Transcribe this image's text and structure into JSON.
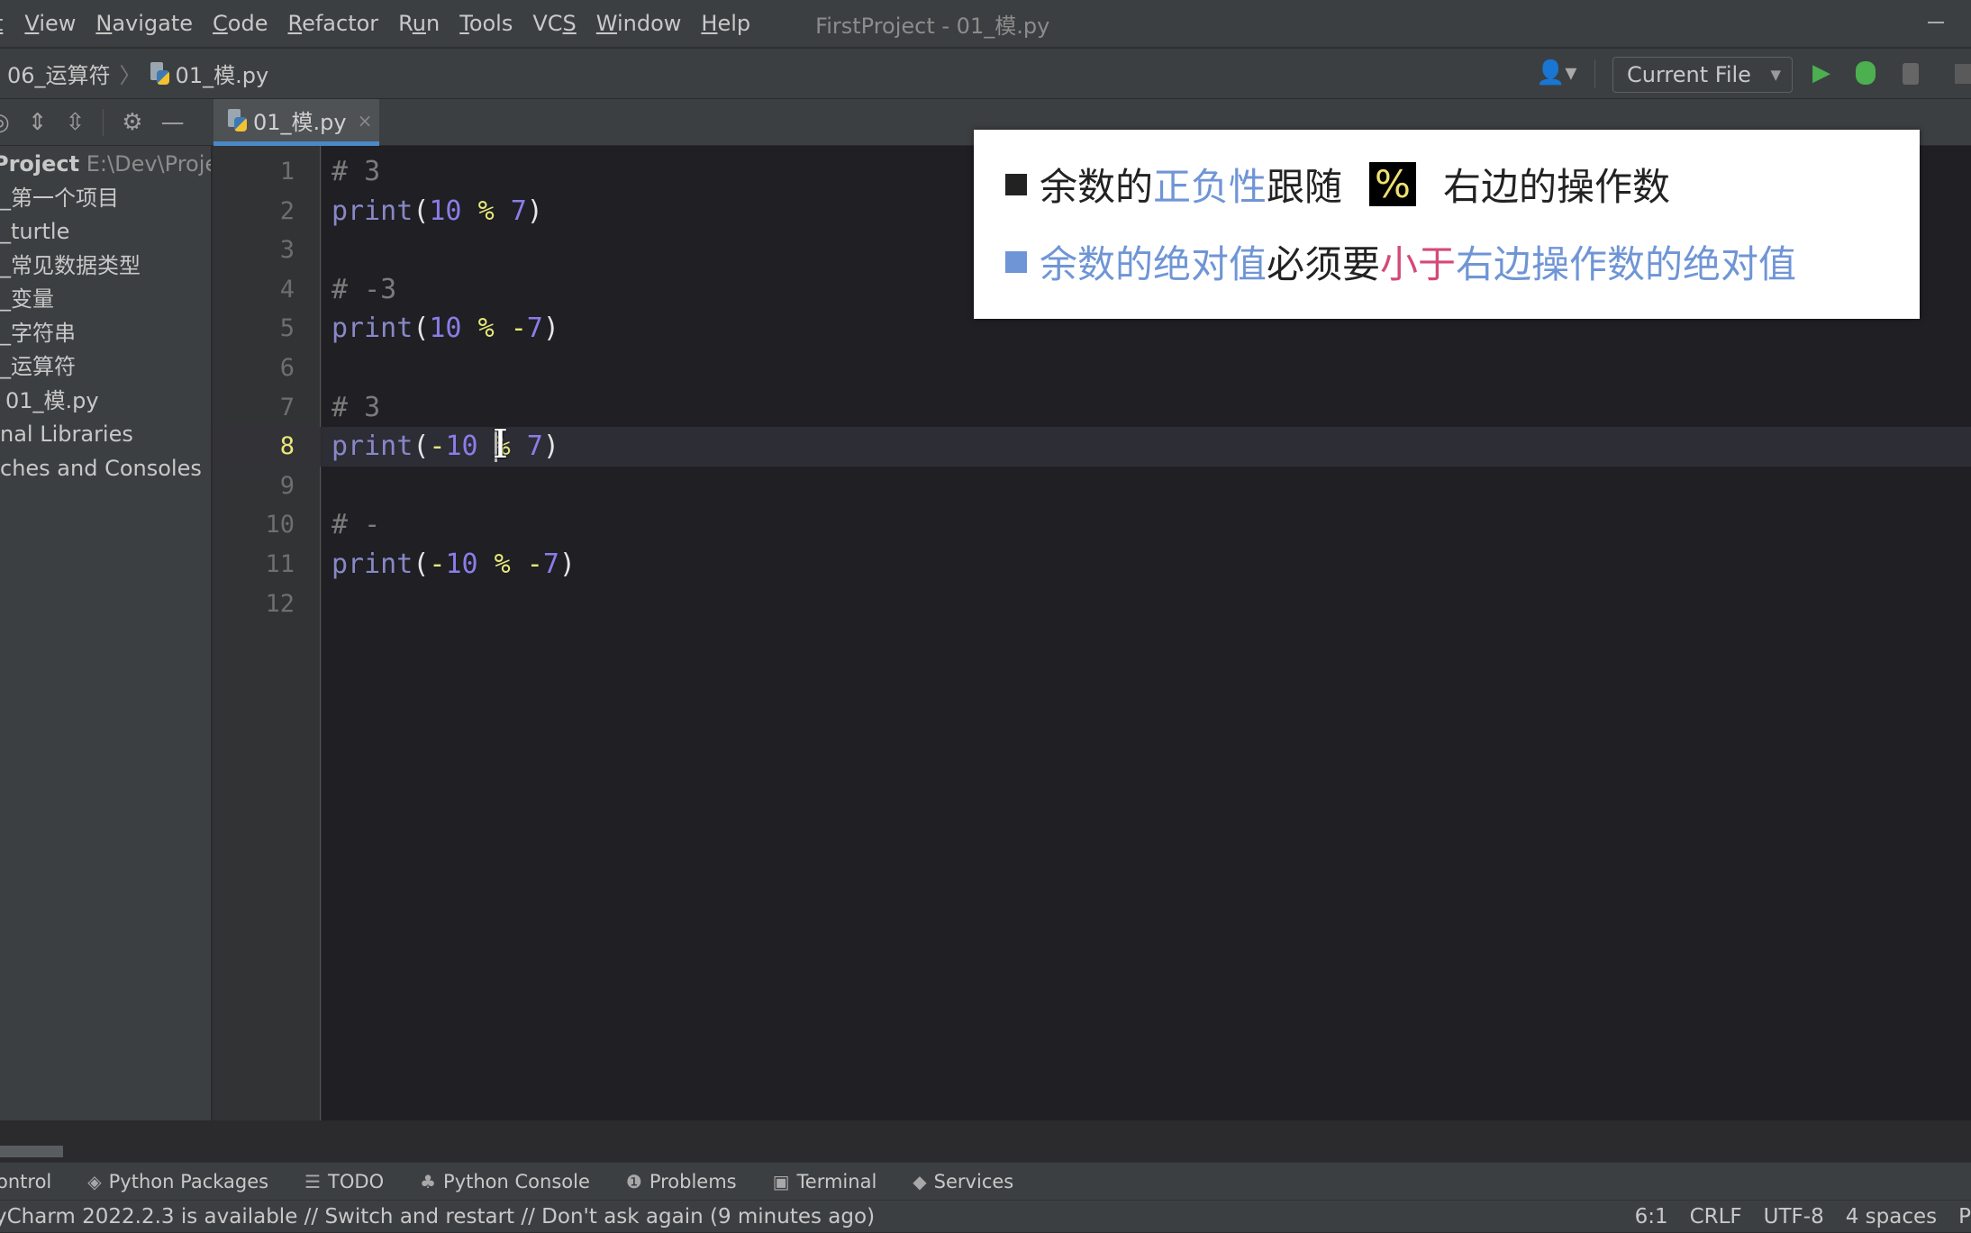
{
  "menu": {
    "items": [
      {
        "pre": "",
        "u": "t",
        "post": "",
        "hidden_prefix": true
      },
      {
        "pre": "",
        "u": "V",
        "post": "iew"
      },
      {
        "pre": "",
        "u": "N",
        "post": "avigate"
      },
      {
        "pre": "",
        "u": "C",
        "post": "ode"
      },
      {
        "pre": "",
        "u": "R",
        "post": "efactor"
      },
      {
        "pre": "R",
        "u": "u",
        "post": "n"
      },
      {
        "pre": "",
        "u": "T",
        "post": "ools"
      },
      {
        "pre": "VC",
        "u": "S",
        "post": ""
      },
      {
        "pre": "",
        "u": "W",
        "post": "indow"
      },
      {
        "pre": "",
        "u": "H",
        "post": "elp"
      }
    ],
    "window_title": "FirstProject - 01_模.py"
  },
  "navbar": {
    "breadcrumb": [
      "06_运算符",
      "01_模.py"
    ],
    "run_config": "Current File"
  },
  "tab": {
    "label": "01_模.py"
  },
  "project": {
    "header_name": "Project",
    "header_path": "E:\\Dev\\Project",
    "items": [
      "_第一个项目",
      "_turtle",
      "_常见数据类型",
      "_变量",
      "_字符串",
      "_运算符",
      "01_模.py",
      "nal Libraries",
      "ches and Consoles"
    ]
  },
  "editor": {
    "current_line": 8,
    "lines": [
      [
        {
          "t": "# 3",
          "c": "comment"
        }
      ],
      [
        {
          "t": "print",
          "c": "fn"
        },
        {
          "t": "(",
          "c": "paren"
        },
        {
          "t": "10",
          "c": "num"
        },
        {
          "t": " ",
          "c": "paren"
        },
        {
          "t": "%",
          "c": "op"
        },
        {
          "t": " ",
          "c": "paren"
        },
        {
          "t": "7",
          "c": "num"
        },
        {
          "t": ")",
          "c": "paren"
        }
      ],
      [],
      [
        {
          "t": "# -3",
          "c": "comment"
        }
      ],
      [
        {
          "t": "print",
          "c": "fn"
        },
        {
          "t": "(",
          "c": "paren"
        },
        {
          "t": "10",
          "c": "num"
        },
        {
          "t": " ",
          "c": "paren"
        },
        {
          "t": "%",
          "c": "op"
        },
        {
          "t": " ",
          "c": "paren"
        },
        {
          "t": "-",
          "c": "op"
        },
        {
          "t": "7",
          "c": "num"
        },
        {
          "t": ")",
          "c": "paren"
        }
      ],
      [],
      [
        {
          "t": "# 3",
          "c": "comment"
        }
      ],
      [
        {
          "t": "print",
          "c": "fn"
        },
        {
          "t": "(",
          "c": "paren"
        },
        {
          "t": "-",
          "c": "op"
        },
        {
          "t": "10",
          "c": "num"
        },
        {
          "t": " ",
          "c": "paren"
        },
        {
          "t": "%",
          "c": "op"
        },
        {
          "t": " ",
          "c": "paren"
        },
        {
          "t": "7",
          "c": "num"
        },
        {
          "t": ")",
          "c": "paren"
        }
      ],
      [],
      [
        {
          "t": "# -",
          "c": "comment"
        }
      ],
      [
        {
          "t": "print",
          "c": "fn"
        },
        {
          "t": "(",
          "c": "paren"
        },
        {
          "t": "-",
          "c": "op"
        },
        {
          "t": "10",
          "c": "num"
        },
        {
          "t": " ",
          "c": "paren"
        },
        {
          "t": "%",
          "c": "op"
        },
        {
          "t": " ",
          "c": "paren"
        },
        {
          "t": "-",
          "c": "op"
        },
        {
          "t": "7",
          "c": "num"
        },
        {
          "t": ")",
          "c": "paren"
        }
      ],
      []
    ]
  },
  "overlay": {
    "line1": [
      {
        "t": "余数的",
        "color": "#222222"
      },
      {
        "t": "正负性",
        "color": "#6f95d6"
      },
      {
        "t": "跟随",
        "color": "#222222"
      },
      {
        "t": "%",
        "box": true
      },
      {
        "t": "右边的操作数",
        "color": "#222222"
      }
    ],
    "line1_bullet_color": "#222222",
    "line2": [
      {
        "t": "余数的绝对值",
        "color": "#6f95d6"
      },
      {
        "t": "必须要",
        "color": "#222222"
      },
      {
        "t": "小于",
        "color": "#d4497a"
      },
      {
        "t": "右边操作数的绝对值",
        "color": "#6f95d6"
      }
    ],
    "line2_bullet_color": "#6f95d6"
  },
  "toolwindows": [
    {
      "label": "ontrol",
      "icon": ""
    },
    {
      "label": "Python Packages",
      "icon": "layers-icon"
    },
    {
      "label": "TODO",
      "icon": "list-icon"
    },
    {
      "label": "Python Console",
      "icon": "python-icon"
    },
    {
      "label": "Problems",
      "icon": "warning-icon"
    },
    {
      "label": "Terminal",
      "icon": "terminal-icon"
    },
    {
      "label": "Services",
      "icon": "services-icon"
    }
  ],
  "status": {
    "message": "yCharm 2022.2.3 is available // Switch and restart // Don't ask again (9 minutes ago)",
    "position": "6:1",
    "line_sep": "CRLF",
    "encoding": "UTF-8",
    "indent": "4 spaces",
    "interpreter": "P"
  },
  "colors": {
    "accent": "#4a88c7",
    "run": "#4caf50",
    "debug": "#4caf50"
  }
}
